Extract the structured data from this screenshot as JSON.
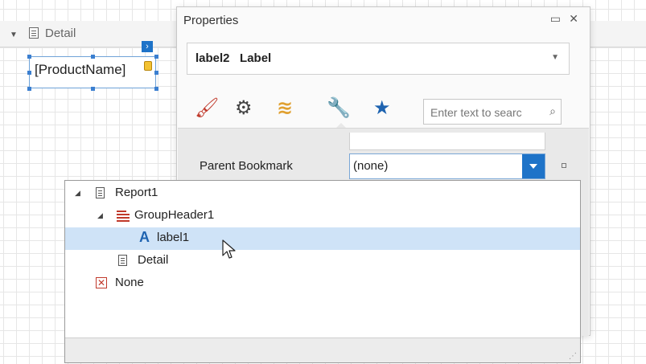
{
  "band": {
    "label": "Detail"
  },
  "label_control": {
    "text": "[ProductName]",
    "smart_tag": "›"
  },
  "properties": {
    "title": "Properties",
    "window_buttons": {
      "restore": "▭",
      "close": "✕"
    },
    "selector_value": "label2   Label",
    "tabs": [
      {
        "icon": "brush-icon",
        "glyph": "🖌",
        "color": "#c0392b"
      },
      {
        "icon": "gear-icon",
        "glyph": "⚙",
        "color": "#444444"
      },
      {
        "icon": "database-icon",
        "glyph": "≋",
        "color": "#e0a030"
      },
      {
        "icon": "wrench-icon",
        "glyph": "🔧",
        "color": "#333333"
      },
      {
        "icon": "star-icon",
        "glyph": "★",
        "color": "#1e63b0"
      }
    ],
    "search_placeholder": "Enter text to searc",
    "property": {
      "label": "Parent Bookmark",
      "value": "(none)"
    }
  },
  "tree": {
    "items": [
      {
        "label": "Report1",
        "icon": "report-icon",
        "expanded": true
      },
      {
        "label": "GroupHeader1",
        "icon": "group-header-icon",
        "expanded": true
      },
      {
        "label": "label1",
        "icon": "label-icon",
        "selected": true
      },
      {
        "label": "Detail",
        "icon": "detail-band-icon"
      },
      {
        "label": "None",
        "icon": "none-icon"
      }
    ]
  },
  "colors": {
    "accent": "#1e73c8",
    "selection": "#cfe3f7"
  }
}
